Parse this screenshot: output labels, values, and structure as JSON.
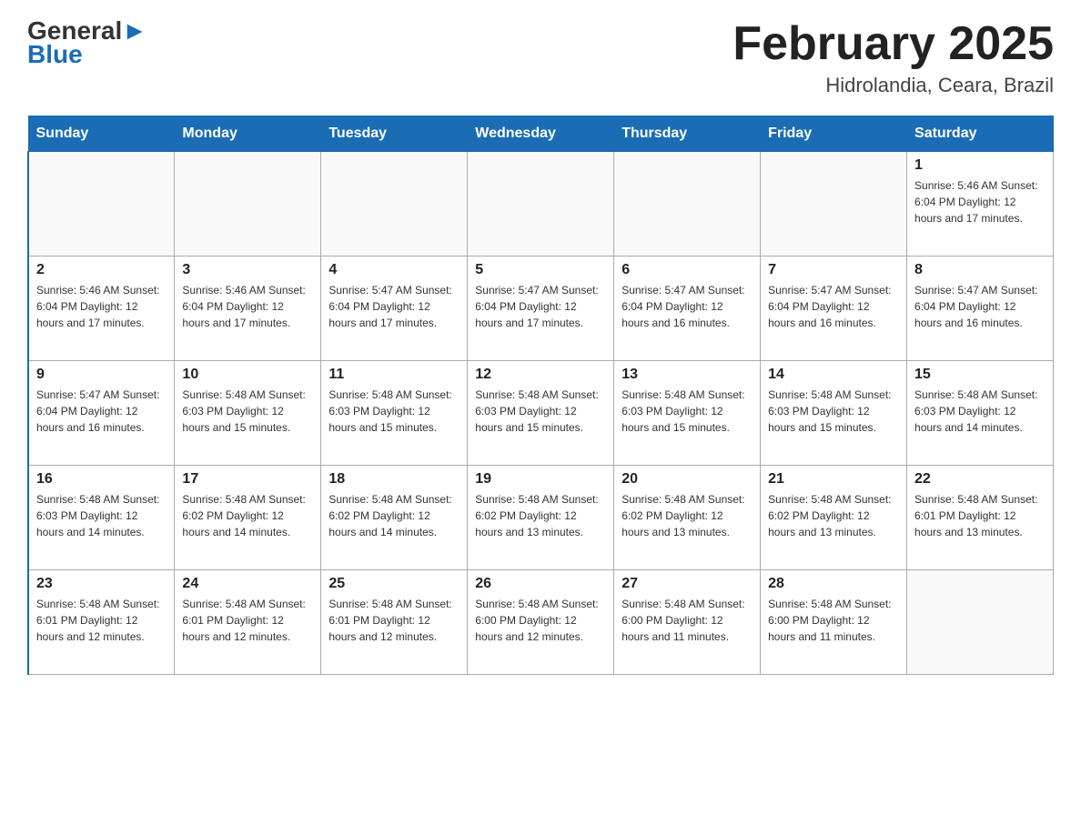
{
  "logo": {
    "top": "General",
    "arrow": "▶",
    "bottom": "Blue"
  },
  "title": "February 2025",
  "subtitle": "Hidrolandia, Ceara, Brazil",
  "weekdays": [
    "Sunday",
    "Monday",
    "Tuesday",
    "Wednesday",
    "Thursday",
    "Friday",
    "Saturday"
  ],
  "weeks": [
    [
      {
        "day": "",
        "info": ""
      },
      {
        "day": "",
        "info": ""
      },
      {
        "day": "",
        "info": ""
      },
      {
        "day": "",
        "info": ""
      },
      {
        "day": "",
        "info": ""
      },
      {
        "day": "",
        "info": ""
      },
      {
        "day": "1",
        "info": "Sunrise: 5:46 AM\nSunset: 6:04 PM\nDaylight: 12 hours\nand 17 minutes."
      }
    ],
    [
      {
        "day": "2",
        "info": "Sunrise: 5:46 AM\nSunset: 6:04 PM\nDaylight: 12 hours\nand 17 minutes."
      },
      {
        "day": "3",
        "info": "Sunrise: 5:46 AM\nSunset: 6:04 PM\nDaylight: 12 hours\nand 17 minutes."
      },
      {
        "day": "4",
        "info": "Sunrise: 5:47 AM\nSunset: 6:04 PM\nDaylight: 12 hours\nand 17 minutes."
      },
      {
        "day": "5",
        "info": "Sunrise: 5:47 AM\nSunset: 6:04 PM\nDaylight: 12 hours\nand 17 minutes."
      },
      {
        "day": "6",
        "info": "Sunrise: 5:47 AM\nSunset: 6:04 PM\nDaylight: 12 hours\nand 16 minutes."
      },
      {
        "day": "7",
        "info": "Sunrise: 5:47 AM\nSunset: 6:04 PM\nDaylight: 12 hours\nand 16 minutes."
      },
      {
        "day": "8",
        "info": "Sunrise: 5:47 AM\nSunset: 6:04 PM\nDaylight: 12 hours\nand 16 minutes."
      }
    ],
    [
      {
        "day": "9",
        "info": "Sunrise: 5:47 AM\nSunset: 6:04 PM\nDaylight: 12 hours\nand 16 minutes."
      },
      {
        "day": "10",
        "info": "Sunrise: 5:48 AM\nSunset: 6:03 PM\nDaylight: 12 hours\nand 15 minutes."
      },
      {
        "day": "11",
        "info": "Sunrise: 5:48 AM\nSunset: 6:03 PM\nDaylight: 12 hours\nand 15 minutes."
      },
      {
        "day": "12",
        "info": "Sunrise: 5:48 AM\nSunset: 6:03 PM\nDaylight: 12 hours\nand 15 minutes."
      },
      {
        "day": "13",
        "info": "Sunrise: 5:48 AM\nSunset: 6:03 PM\nDaylight: 12 hours\nand 15 minutes."
      },
      {
        "day": "14",
        "info": "Sunrise: 5:48 AM\nSunset: 6:03 PM\nDaylight: 12 hours\nand 15 minutes."
      },
      {
        "day": "15",
        "info": "Sunrise: 5:48 AM\nSunset: 6:03 PM\nDaylight: 12 hours\nand 14 minutes."
      }
    ],
    [
      {
        "day": "16",
        "info": "Sunrise: 5:48 AM\nSunset: 6:03 PM\nDaylight: 12 hours\nand 14 minutes."
      },
      {
        "day": "17",
        "info": "Sunrise: 5:48 AM\nSunset: 6:02 PM\nDaylight: 12 hours\nand 14 minutes."
      },
      {
        "day": "18",
        "info": "Sunrise: 5:48 AM\nSunset: 6:02 PM\nDaylight: 12 hours\nand 14 minutes."
      },
      {
        "day": "19",
        "info": "Sunrise: 5:48 AM\nSunset: 6:02 PM\nDaylight: 12 hours\nand 13 minutes."
      },
      {
        "day": "20",
        "info": "Sunrise: 5:48 AM\nSunset: 6:02 PM\nDaylight: 12 hours\nand 13 minutes."
      },
      {
        "day": "21",
        "info": "Sunrise: 5:48 AM\nSunset: 6:02 PM\nDaylight: 12 hours\nand 13 minutes."
      },
      {
        "day": "22",
        "info": "Sunrise: 5:48 AM\nSunset: 6:01 PM\nDaylight: 12 hours\nand 13 minutes."
      }
    ],
    [
      {
        "day": "23",
        "info": "Sunrise: 5:48 AM\nSunset: 6:01 PM\nDaylight: 12 hours\nand 12 minutes."
      },
      {
        "day": "24",
        "info": "Sunrise: 5:48 AM\nSunset: 6:01 PM\nDaylight: 12 hours\nand 12 minutes."
      },
      {
        "day": "25",
        "info": "Sunrise: 5:48 AM\nSunset: 6:01 PM\nDaylight: 12 hours\nand 12 minutes."
      },
      {
        "day": "26",
        "info": "Sunrise: 5:48 AM\nSunset: 6:00 PM\nDaylight: 12 hours\nand 12 minutes."
      },
      {
        "day": "27",
        "info": "Sunrise: 5:48 AM\nSunset: 6:00 PM\nDaylight: 12 hours\nand 11 minutes."
      },
      {
        "day": "28",
        "info": "Sunrise: 5:48 AM\nSunset: 6:00 PM\nDaylight: 12 hours\nand 11 minutes."
      },
      {
        "day": "",
        "info": ""
      }
    ]
  ]
}
